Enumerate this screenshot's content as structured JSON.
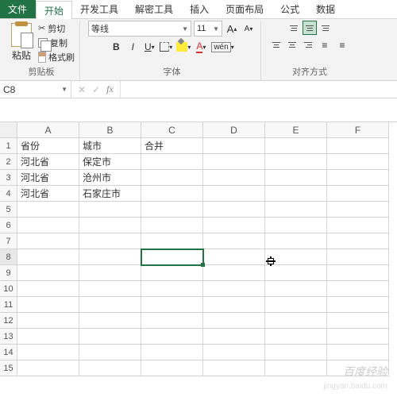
{
  "tabs": {
    "file": "文件",
    "home": "开始",
    "dev": "开发工具",
    "decrypt": "解密工具",
    "insert": "插入",
    "layout": "页面布局",
    "formulas": "公式",
    "data": "数据"
  },
  "ribbon": {
    "clipboard": {
      "label": "剪贴板",
      "cut": "剪切",
      "copy": "复制",
      "paste": "粘贴",
      "format_painter": "格式刷"
    },
    "font": {
      "label": "字体",
      "name": "等线",
      "size": "11",
      "bold": "B",
      "italic": "I",
      "underline": "U",
      "fontcolor_letter": "A",
      "wen": "wén",
      "grow": "A",
      "shrink": "A"
    },
    "align": {
      "label": "对齐方式"
    }
  },
  "namebox": "C8",
  "fx_label": "fx",
  "cols": [
    "A",
    "B",
    "C",
    "D",
    "E",
    "F"
  ],
  "rows": [
    "1",
    "2",
    "3",
    "4",
    "5",
    "6",
    "7",
    "8",
    "9",
    "10",
    "11",
    "12",
    "13",
    "14",
    "15"
  ],
  "cells": {
    "A1": "省份",
    "B1": "城市",
    "C1": "合并",
    "A2": "河北省",
    "B2": "保定市",
    "A3": "河北省",
    "B3": "沧州市",
    "A4": "河北省",
    "B4": "石家庄市"
  },
  "watermark1": "百度经验",
  "watermark2": "jingyan.baidu.com"
}
